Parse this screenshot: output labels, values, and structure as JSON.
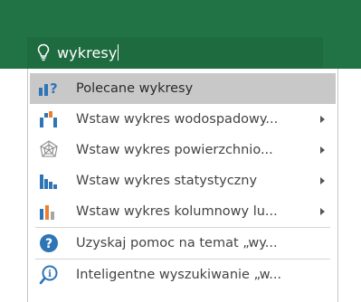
{
  "search": {
    "query": "wykresy",
    "icon": "lightbulb-icon"
  },
  "colors": {
    "ribbon_green": "#217346",
    "search_bg": "#1e6b40",
    "selected_bg": "#c8c8c8"
  },
  "menu": {
    "items": [
      {
        "label": "Polecane wykresy",
        "icon": "recommended-charts-icon",
        "has_submenu": false,
        "selected": true
      },
      {
        "label": "Wstaw wykres wodospadowy...",
        "icon": "waterfall-chart-icon",
        "has_submenu": true
      },
      {
        "label": "Wstaw wykres powierzchnio...",
        "icon": "surface-radar-chart-icon",
        "has_submenu": true
      },
      {
        "label": "Wstaw wykres statystyczny",
        "icon": "statistic-chart-icon",
        "has_submenu": true
      },
      {
        "label": "Wstaw wykres kolumnowy lu...",
        "icon": "column-bar-chart-icon",
        "has_submenu": true
      }
    ],
    "help_items": [
      {
        "label": "Uzyskaj pomoc na temat „wy...",
        "icon": "help-icon"
      },
      {
        "label": "Inteligentne wyszukiwanie „w...",
        "icon": "smart-lookup-icon"
      }
    ]
  }
}
